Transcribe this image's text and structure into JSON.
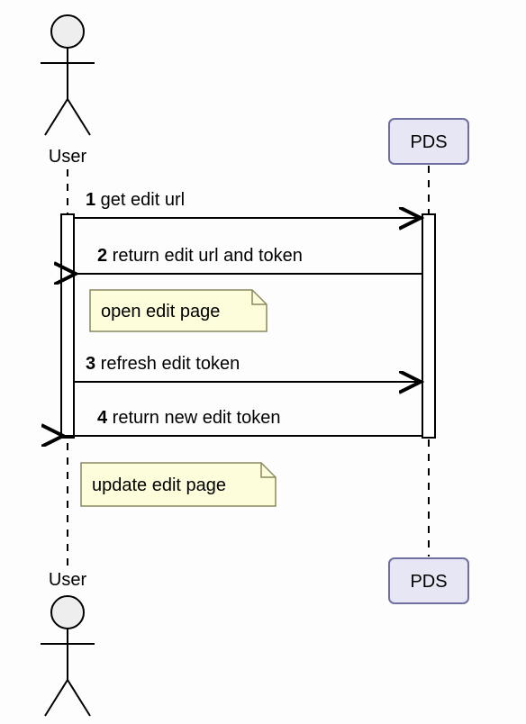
{
  "actors": {
    "left_top": "User",
    "left_bottom": "User",
    "right_top": "PDS",
    "right_bottom": "PDS"
  },
  "messages": {
    "m1_num": "1",
    "m1_text": " get edit url",
    "m2_num": "2",
    "m2_text": " return edit url and token",
    "m3_num": "3",
    "m3_text": " refresh edit token",
    "m4_num": "4",
    "m4_text": " return new edit token"
  },
  "notes": {
    "n1": "open edit page",
    "n2": "update edit page"
  }
}
